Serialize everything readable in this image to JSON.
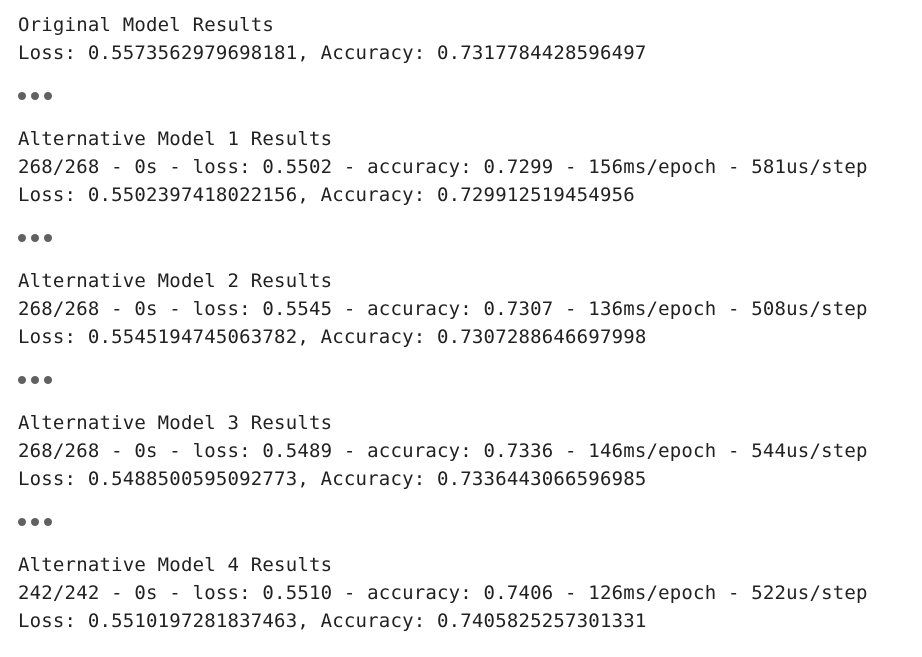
{
  "blocks": [
    {
      "title": "Original Model Results",
      "lines": [
        "Loss: 0.5573562979698181, Accuracy: 0.7317784428596497"
      ]
    },
    {
      "title": "Alternative Model 1 Results",
      "lines": [
        "268/268 - 0s - loss: 0.5502 - accuracy: 0.7299 - 156ms/epoch - 581us/step",
        "Loss: 0.5502397418022156, Accuracy: 0.729912519454956"
      ]
    },
    {
      "title": "Alternative Model 2 Results",
      "lines": [
        "268/268 - 0s - loss: 0.5545 - accuracy: 0.7307 - 136ms/epoch - 508us/step",
        "Loss: 0.5545194745063782, Accuracy: 0.7307288646697998"
      ]
    },
    {
      "title": "Alternative Model 3 Results",
      "lines": [
        "268/268 - 0s - loss: 0.5489 - accuracy: 0.7336 - 146ms/epoch - 544us/step",
        "Loss: 0.5488500595092773, Accuracy: 0.7336443066596985"
      ]
    },
    {
      "title": "Alternative Model 4 Results",
      "lines": [
        "242/242 - 0s - loss: 0.5510 - accuracy: 0.7406 - 126ms/epoch - 522us/step",
        "Loss: 0.5510197281837463, Accuracy: 0.7405825257301331"
      ]
    }
  ],
  "collapsed_output_icon": "ellipsis-icon"
}
